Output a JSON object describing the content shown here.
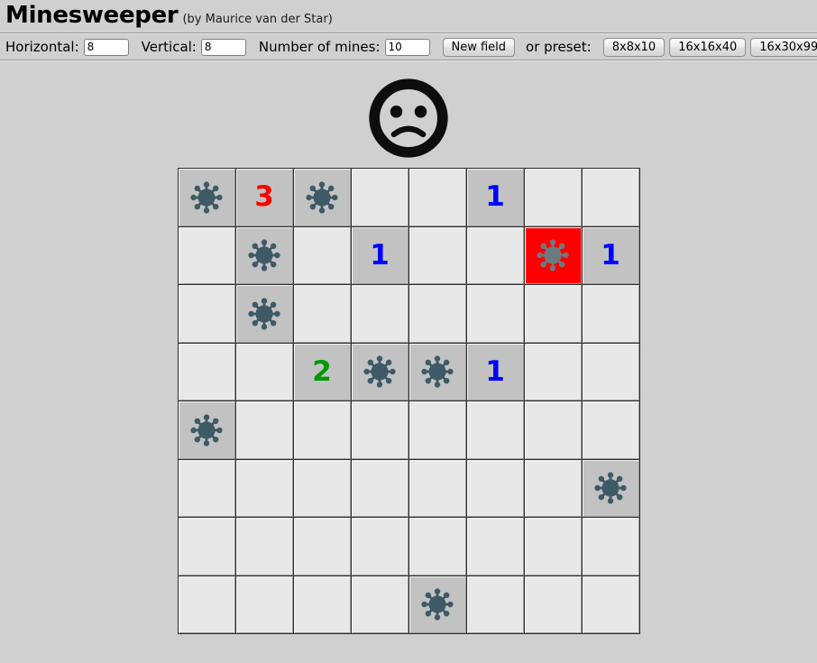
{
  "header": {
    "title": "Minesweeper",
    "author": "(by Maurice van der Star)"
  },
  "toolbar": {
    "horizontal_label": "Horizontal:",
    "horizontal_value": "8",
    "vertical_label": "Vertical:",
    "vertical_value": "8",
    "mines_label": "Number of mines:",
    "mines_value": "10",
    "new_field_label": "New field",
    "preset_label": "or preset:",
    "presets": [
      {
        "label": "8x8x10"
      },
      {
        "label": "16x16x40"
      },
      {
        "label": "16x30x99"
      }
    ]
  },
  "face": {
    "state": "sad",
    "icon": "sad-face-icon"
  },
  "board": {
    "columns": 8,
    "rows": 8,
    "colors": {
      "cell_hidden": "#e8e8e8",
      "cell_revealed": "#c2c2c2",
      "cell_exploded": "#ff0000",
      "grid_line": "#2b2b2b",
      "mine_body": "#3e5a66",
      "number_1": "#0000ff",
      "number_2": "#009900",
      "number_3": "#ff0000"
    },
    "cells": [
      [
        {
          "type": "mine"
        },
        {
          "type": "number",
          "value": "3"
        },
        {
          "type": "mine"
        },
        {
          "type": "blank"
        },
        {
          "type": "blank"
        },
        {
          "type": "number",
          "value": "1"
        },
        {
          "type": "blank"
        },
        {
          "type": "blank"
        }
      ],
      [
        {
          "type": "blank"
        },
        {
          "type": "mine"
        },
        {
          "type": "blank"
        },
        {
          "type": "number",
          "value": "1"
        },
        {
          "type": "blank"
        },
        {
          "type": "blank"
        },
        {
          "type": "mine-exploded"
        },
        {
          "type": "number",
          "value": "1"
        }
      ],
      [
        {
          "type": "blank"
        },
        {
          "type": "mine"
        },
        {
          "type": "blank"
        },
        {
          "type": "blank"
        },
        {
          "type": "blank"
        },
        {
          "type": "blank"
        },
        {
          "type": "blank"
        },
        {
          "type": "blank"
        }
      ],
      [
        {
          "type": "blank"
        },
        {
          "type": "blank"
        },
        {
          "type": "number",
          "value": "2"
        },
        {
          "type": "mine"
        },
        {
          "type": "mine"
        },
        {
          "type": "number",
          "value": "1"
        },
        {
          "type": "blank"
        },
        {
          "type": "blank"
        }
      ],
      [
        {
          "type": "mine"
        },
        {
          "type": "blank"
        },
        {
          "type": "blank"
        },
        {
          "type": "blank"
        },
        {
          "type": "blank"
        },
        {
          "type": "blank"
        },
        {
          "type": "blank"
        },
        {
          "type": "blank"
        }
      ],
      [
        {
          "type": "blank"
        },
        {
          "type": "blank"
        },
        {
          "type": "blank"
        },
        {
          "type": "blank"
        },
        {
          "type": "blank"
        },
        {
          "type": "blank"
        },
        {
          "type": "blank"
        },
        {
          "type": "mine"
        }
      ],
      [
        {
          "type": "blank"
        },
        {
          "type": "blank"
        },
        {
          "type": "blank"
        },
        {
          "type": "blank"
        },
        {
          "type": "blank"
        },
        {
          "type": "blank"
        },
        {
          "type": "blank"
        },
        {
          "type": "blank"
        }
      ],
      [
        {
          "type": "blank"
        },
        {
          "type": "blank"
        },
        {
          "type": "blank"
        },
        {
          "type": "blank"
        },
        {
          "type": "mine"
        },
        {
          "type": "blank"
        },
        {
          "type": "blank"
        },
        {
          "type": "blank"
        }
      ]
    ]
  }
}
